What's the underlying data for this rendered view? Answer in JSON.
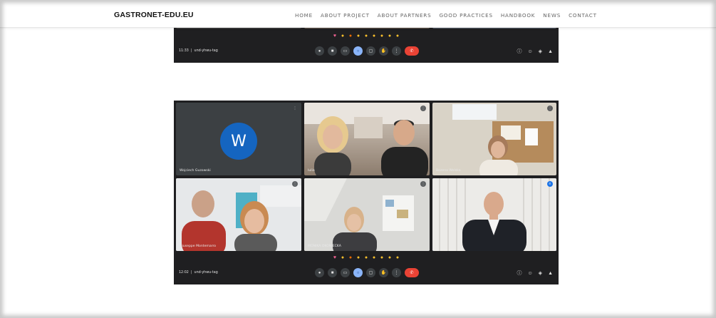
{
  "site": {
    "logo": "GASTRONET-EDU.EU",
    "nav": [
      "HOME",
      "ABOUT PROJECT",
      "ABOUT PARTNERS",
      "GOOD PRACTICES",
      "HANDBOOK",
      "NEWS",
      "CONTACT"
    ]
  },
  "meeting_top": {
    "time": "11:33",
    "code": "und-yhwu-tag"
  },
  "meeting_main": {
    "time": "12:02",
    "code": "und-yhwu-tag",
    "avatar_letter": "W",
    "participants": [
      {
        "name": "Wojciech Guzowski"
      },
      {
        "name": "Iulia"
      },
      {
        "name": "Bozena Wolska"
      },
      {
        "name": "Giuseppe Montemarro"
      },
      {
        "name": "MONIKA OKONIECKA"
      },
      {
        "name": ""
      }
    ]
  },
  "reactions": [
    "heart",
    "thumbs-up",
    "party",
    "clap",
    "laugh",
    "surprised",
    "sad",
    "thinking",
    "thumbs-down"
  ],
  "colors": {
    "meet_bg": "#1f1f21",
    "tile_bg": "#3c4043",
    "avatar": "#1565c0",
    "end_call": "#ea4335",
    "active": "#8ab4f8"
  }
}
